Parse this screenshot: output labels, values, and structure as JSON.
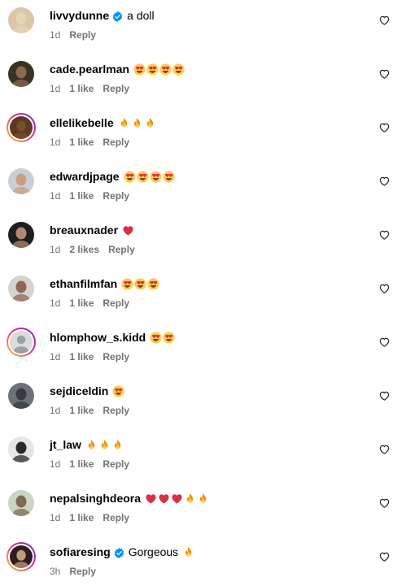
{
  "comments": [
    {
      "username": "livvydunne",
      "verified": true,
      "text": "a doll",
      "emojis": [],
      "time": "1d",
      "likes": "",
      "reply": "Reply",
      "avatar": {
        "ring": false,
        "bg": "#d9c7a8",
        "face": "#e8d3b4"
      }
    },
    {
      "username": "cade.pearlman",
      "verified": false,
      "text": "",
      "emojis": [
        "heart-eyes",
        "heart-eyes",
        "heart-eyes",
        "heart-eyes"
      ],
      "time": "1d",
      "likes": "1 like",
      "reply": "Reply",
      "avatar": {
        "ring": false,
        "bg": "#3b3226",
        "face": "#8a6a4e"
      }
    },
    {
      "username": "ellelikebelle",
      "verified": false,
      "text": "",
      "emojis": [
        "fire",
        "fire",
        "fire"
      ],
      "time": "1d",
      "likes": "1 like",
      "reply": "Reply",
      "avatar": {
        "ring": true,
        "bg": "#5a3a22",
        "face": "#7b4d2c"
      }
    },
    {
      "username": "edwardjpage",
      "verified": false,
      "text": "",
      "emojis": [
        "heart-eyes",
        "heart-eyes",
        "heart-eyes",
        "heart-eyes"
      ],
      "time": "1d",
      "likes": "1 like",
      "reply": "Reply",
      "avatar": {
        "ring": false,
        "bg": "#c9cfd4",
        "face": "#caa081"
      }
    },
    {
      "username": "breauxnader",
      "verified": false,
      "text": "",
      "emojis": [
        "red-heart"
      ],
      "time": "1d",
      "likes": "2 likes",
      "reply": "Reply",
      "avatar": {
        "ring": false,
        "bg": "#1e1e1e",
        "face": "#b08a70"
      }
    },
    {
      "username": "ethanfilmfan",
      "verified": false,
      "text": "",
      "emojis": [
        "heart-eyes",
        "heart-eyes",
        "heart-eyes"
      ],
      "time": "1d",
      "likes": "1 like",
      "reply": "Reply",
      "avatar": {
        "ring": false,
        "bg": "#d7d3cf",
        "face": "#8b6b55"
      }
    },
    {
      "username": "hlomphow_s.kidd",
      "verified": false,
      "text": "",
      "emojis": [
        "heart-eyes",
        "heart-eyes"
      ],
      "time": "1d",
      "likes": "1 like",
      "reply": "Reply",
      "avatar": {
        "ring": true,
        "bg": "#c7c7c7",
        "face": "#c7c7c7",
        "placeholder": true
      }
    },
    {
      "username": "sejdiceldin",
      "verified": false,
      "text": "",
      "emojis": [
        "heart-eyes"
      ],
      "time": "1d",
      "likes": "1 like",
      "reply": "Reply",
      "avatar": {
        "ring": false,
        "bg": "#6b7279",
        "face": "#3a3a3a"
      }
    },
    {
      "username": "jt_law",
      "verified": false,
      "text": "",
      "emojis": [
        "fire",
        "fire",
        "fire"
      ],
      "time": "1d",
      "likes": "1 like",
      "reply": "Reply",
      "avatar": {
        "ring": false,
        "bg": "#e6e6e6",
        "face": "#2a2a2a"
      }
    },
    {
      "username": "nepalsinghdeora",
      "verified": false,
      "text": "",
      "emojis": [
        "red-heart",
        "red-heart",
        "red-heart",
        "fire",
        "fire"
      ],
      "time": "1d",
      "likes": "1 like",
      "reply": "Reply",
      "avatar": {
        "ring": false,
        "bg": "#c9d6c4",
        "face": "#7f6a52"
      }
    },
    {
      "username": "sofiaresing",
      "verified": true,
      "text": "Gorgeous",
      "emojis": [
        "fire"
      ],
      "time": "3h",
      "likes": "",
      "reply": "Reply",
      "avatar": {
        "ring": true,
        "bg": "#2b1f1c",
        "face": "#c49a82"
      }
    }
  ],
  "colors": {
    "meta_text": "#737373",
    "verified_blue": "#0095f6",
    "heart_outline": "#262626"
  }
}
